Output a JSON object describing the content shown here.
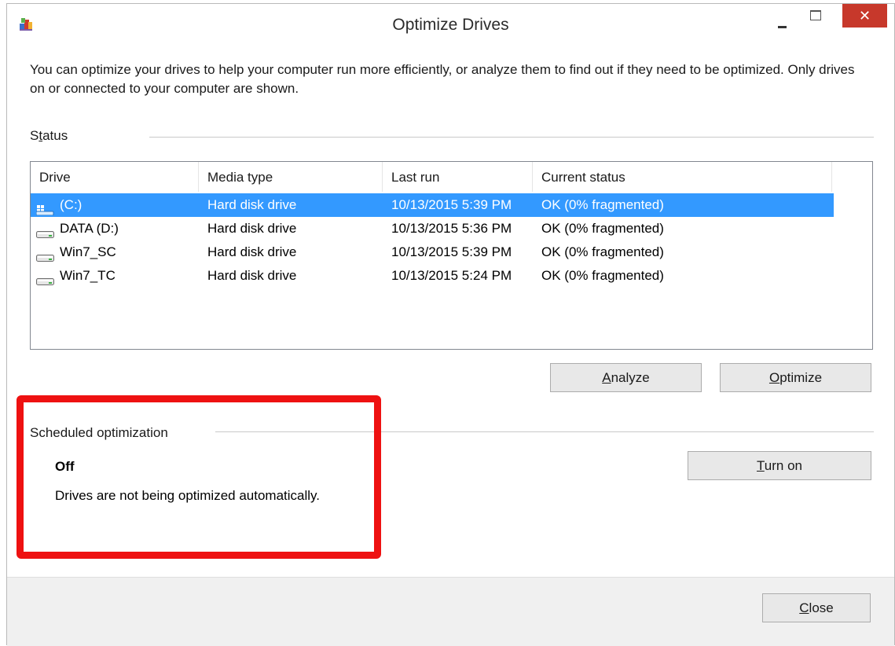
{
  "window": {
    "title": "Optimize Drives",
    "close_glyph": "✕"
  },
  "description": "You can optimize your drives to help your computer run more efficiently, or analyze them to find out if they need to be optimized. Only drives on or connected to your computer are shown.",
  "status_section": {
    "label_prefix": "S",
    "label_underlined": "t",
    "label_suffix": "atus"
  },
  "drive_list": {
    "columns": [
      "Drive",
      "Media type",
      "Last run",
      "Current status"
    ],
    "rows": [
      {
        "name": "(C:)",
        "icon": "windows-drive-icon",
        "media": "Hard disk drive",
        "last_run": "10/13/2015 5:39 PM",
        "status": "OK (0% fragmented)",
        "selected": true
      },
      {
        "name": "DATA (D:)",
        "icon": "hard-drive-icon",
        "media": "Hard disk drive",
        "last_run": "10/13/2015 5:36 PM",
        "status": "OK (0% fragmented)",
        "selected": false
      },
      {
        "name": "Win7_SC",
        "icon": "hard-drive-icon",
        "media": "Hard disk drive",
        "last_run": "10/13/2015 5:39 PM",
        "status": "OK (0% fragmented)",
        "selected": false
      },
      {
        "name": "Win7_TC",
        "icon": "hard-drive-icon",
        "media": "Hard disk drive",
        "last_run": "10/13/2015 5:24 PM",
        "status": "OK (0% fragmented)",
        "selected": false
      }
    ]
  },
  "buttons": {
    "analyze": {
      "ul": "A",
      "rest": "nalyze"
    },
    "optimize": {
      "ul": "O",
      "rest": "ptimize"
    },
    "turn_on": {
      "ul": "T",
      "rest": "urn on"
    },
    "close": {
      "ul": "C",
      "rest": "lose"
    }
  },
  "scheduled": {
    "title": "Scheduled optimization",
    "state": "Off",
    "state_description": "Drives are not being optimized automatically."
  },
  "colors": {
    "selection": "#3399ff",
    "close_button": "#c7382b",
    "highlight_border": "#ee1111"
  }
}
